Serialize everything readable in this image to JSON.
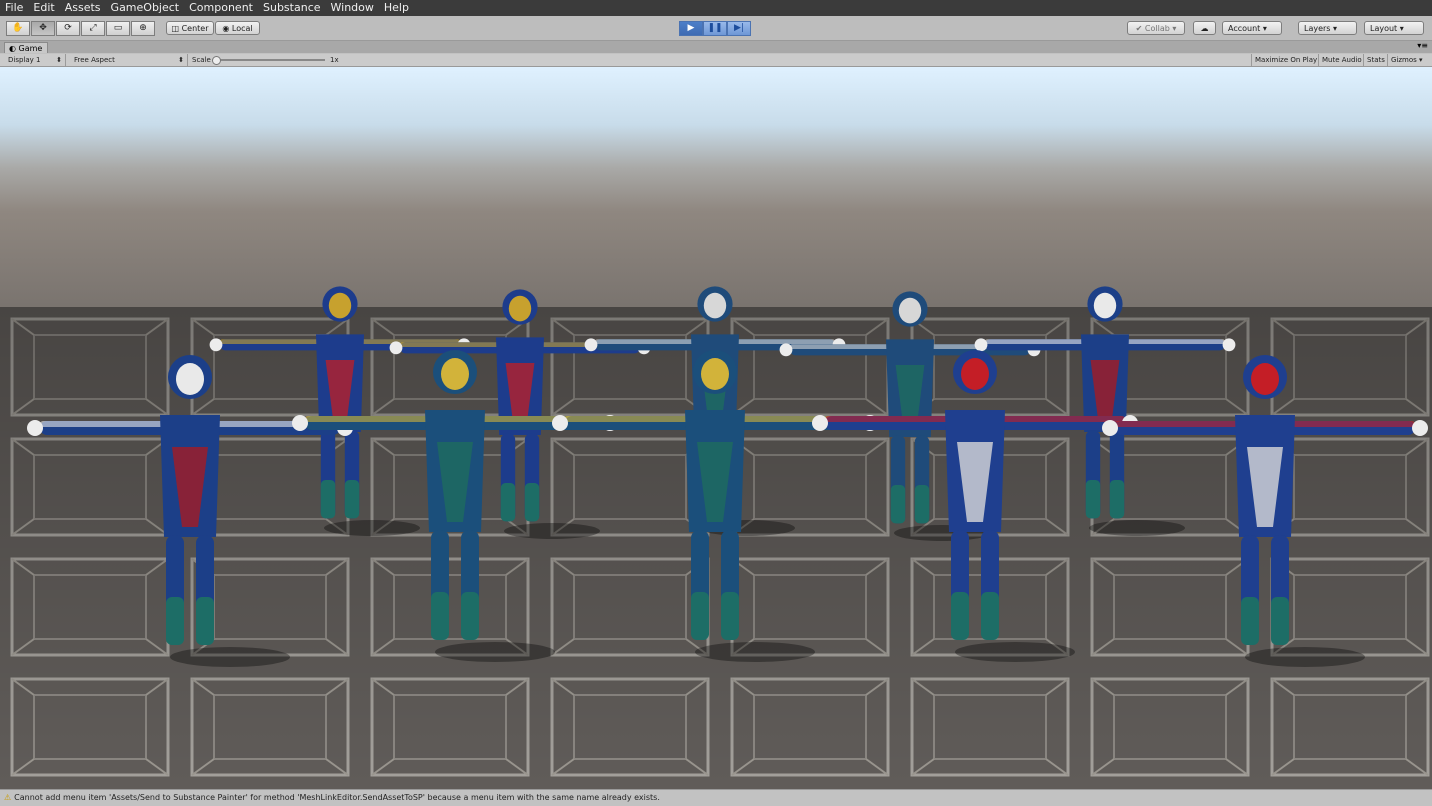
{
  "menu": [
    "File",
    "Edit",
    "Assets",
    "GameObject",
    "Component",
    "Substance",
    "Window",
    "Help"
  ],
  "toolbar": {
    "tools": [
      "hand-tool",
      "move-tool",
      "rotate-tool",
      "scale-tool",
      "rect-tool",
      "transform-tool"
    ],
    "pivot_label": "Center",
    "space_label": "Local",
    "play_controls": [
      "play",
      "pause",
      "step"
    ],
    "collab_label": "Collab",
    "account_label": "Account",
    "layers_label": "Layers",
    "layout_label": "Layout"
  },
  "tab": {
    "label": "Game"
  },
  "gamebar": {
    "display": "Display 1",
    "aspect": "Free Aspect",
    "scale_label": "Scale",
    "scale_value": "1x",
    "maximize": "Maximize On Play",
    "mute": "Mute Audio",
    "stats": "Stats",
    "gizmos": "Gizmos"
  },
  "status": {
    "message": "Cannot add menu item 'Assets/Send to Substance Painter' for method 'MeshLinkEditor.SendAssetToSP' because a menu item with the same name already exists."
  },
  "characters": [
    {
      "name": "hooded-gold-mask"
    },
    {
      "name": "hooded-gold-mask"
    },
    {
      "name": "white-hair"
    },
    {
      "name": "white-hair"
    },
    {
      "name": "blue-mask"
    },
    {
      "name": "blue-mask"
    },
    {
      "name": "gold-armor"
    },
    {
      "name": "gold-armor"
    },
    {
      "name": "red-star"
    },
    {
      "name": "red-star"
    }
  ]
}
